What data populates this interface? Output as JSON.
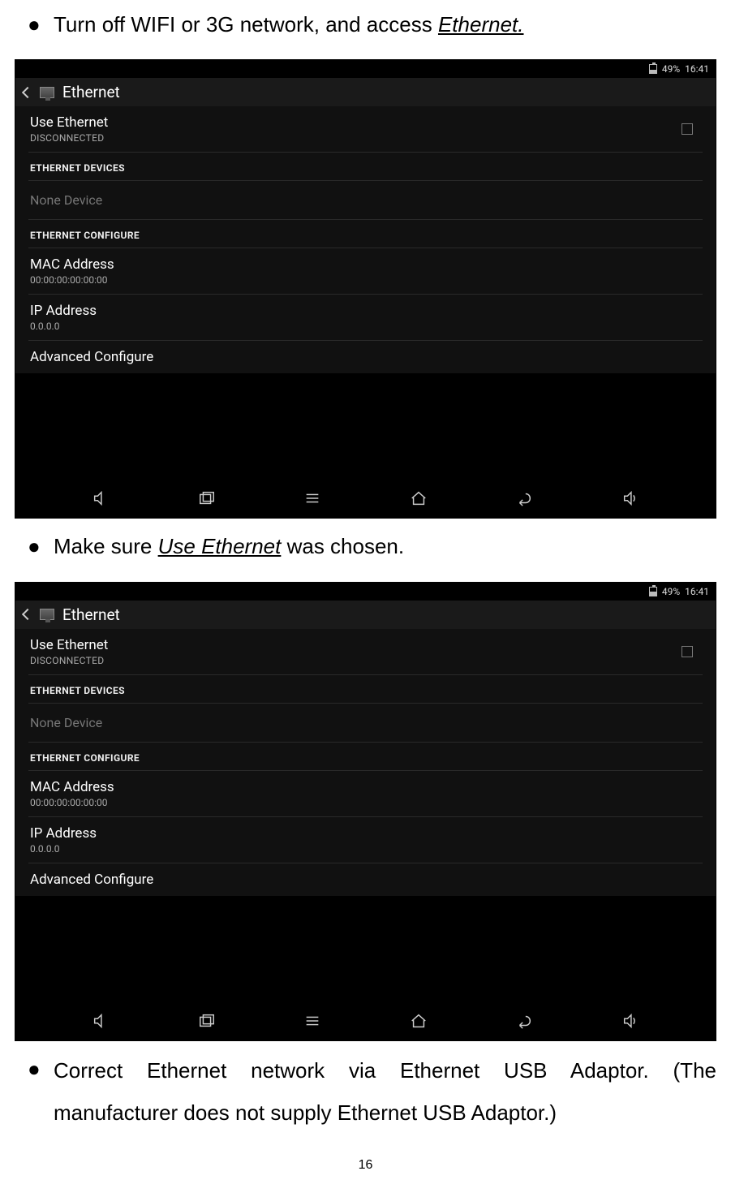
{
  "doc": {
    "bullet1_pre": "Turn off WIFI or 3G network, and access ",
    "bullet1_u": "Ethernet.",
    "bullet2_pre": "Make sure ",
    "bullet2_u": "Use Ethernet",
    "bullet2_post": " was chosen.",
    "bullet3": "Correct  Ethernet  network  via  Ethernet  USB  Adaptor.  (The manufacturer does not supply Ethernet USB Adaptor.)",
    "page_number": "16"
  },
  "screen": {
    "battery_pct": "49%",
    "time": "16:41",
    "title": "Ethernet",
    "use_ethernet": "Use Ethernet",
    "status": "DISCONNECTED",
    "section_devices": "ETHERNET DEVICES",
    "none_device": "None Device",
    "section_configure": "ETHERNET CONFIGURE",
    "mac_label": "MAC Address",
    "mac_value": "00:00:00:00:00:00",
    "ip_label": "IP Address",
    "ip_value": "0.0.0.0",
    "advanced": "Advanced Configure"
  }
}
